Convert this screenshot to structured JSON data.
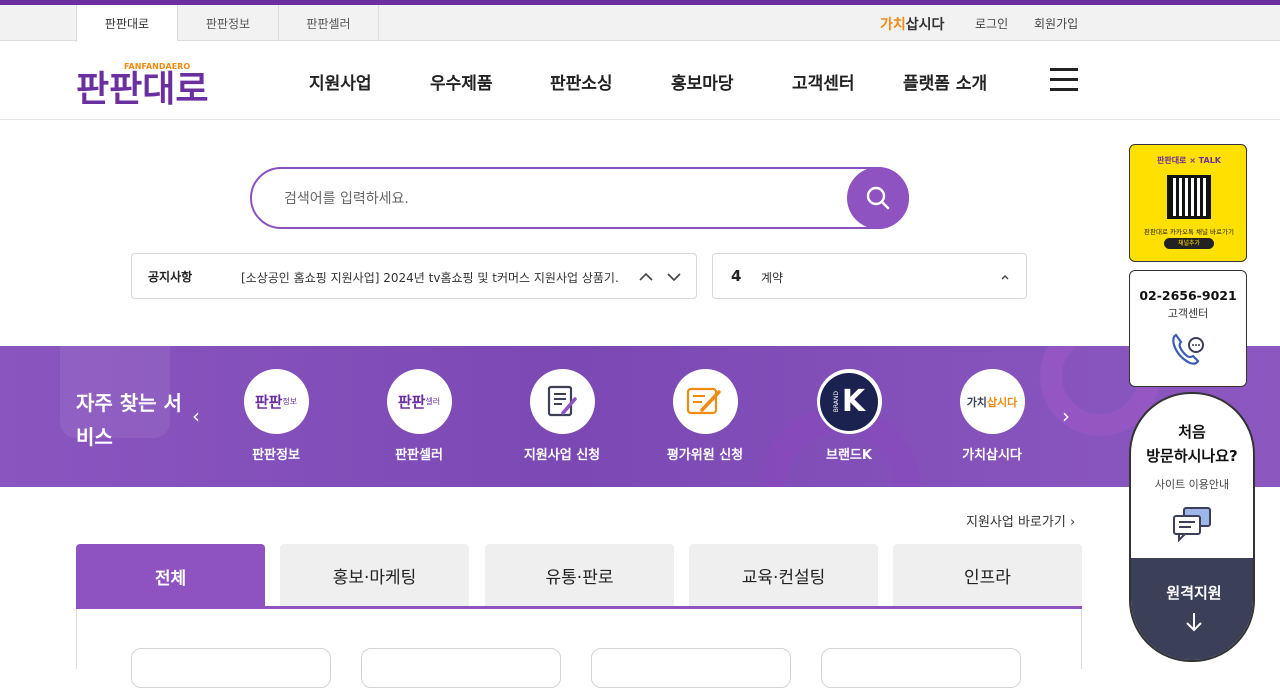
{
  "utility": {
    "tabs": [
      "판판대로",
      "판판정보",
      "판판셀러"
    ],
    "gachi_a": "가치",
    "gachi_b": "삽시다",
    "login": "로그인",
    "signup": "회원가입"
  },
  "logo": {
    "main": "판판대로",
    "sub": "FANFANDAERO"
  },
  "nav": [
    "지원사업",
    "우수제품",
    "판판소싱",
    "홍보마당",
    "고객센터",
    "플랫폼 소개"
  ],
  "search": {
    "placeholder": "검색어를 입력하세요."
  },
  "notice": {
    "label": "공지사항",
    "text": "[소상공인 홈쇼핑 지원사업] 2024년 tv홈쇼핑 및 t커머스 지원사업 상품기..."
  },
  "ranking": {
    "number": "4",
    "keyword": "계약"
  },
  "services": {
    "title": "자주 찾는 서비스",
    "items": [
      {
        "label": "판판정보",
        "icon": "panpan-info-logo"
      },
      {
        "label": "판판셀러",
        "icon": "panpan-seller-logo"
      },
      {
        "label": "지원사업 신청",
        "icon": "document-edit-icon"
      },
      {
        "label": "평가위원 신청",
        "icon": "pencil-note-icon"
      },
      {
        "label": "브랜드K",
        "icon": "brand-k-logo"
      },
      {
        "label": "가치삽시다",
        "icon": "gachi-logo"
      }
    ],
    "logo_texts": {
      "panpan": "판판",
      "info": "정보",
      "seller": "셀러",
      "k": "K",
      "brand": "BRAND",
      "gachi_a": "가치",
      "gachi_b": "삽시다"
    }
  },
  "shortcut": "지원사업 바로가기",
  "tabs": [
    "전체",
    "홍보·마케팅",
    "유통·판로",
    "교육·컨설팅",
    "인프라"
  ],
  "quick": {
    "qr_title": "판판대로 × TALK",
    "qr_caption": "판판대로 카카오톡 채널 바로가기",
    "qr_button": "채널추가",
    "phone": "02-2656-9021",
    "cs_label": "고객센터",
    "guide_title_1": "처음",
    "guide_title_2": "방문하시나요?",
    "guide_sub": "사이트 이용안내",
    "remote": "원격지원"
  },
  "colors": {
    "brand": "#8e53c0",
    "dark": "#3b3f58",
    "kakao": "#ffe000",
    "gachi": "#f08a10"
  }
}
